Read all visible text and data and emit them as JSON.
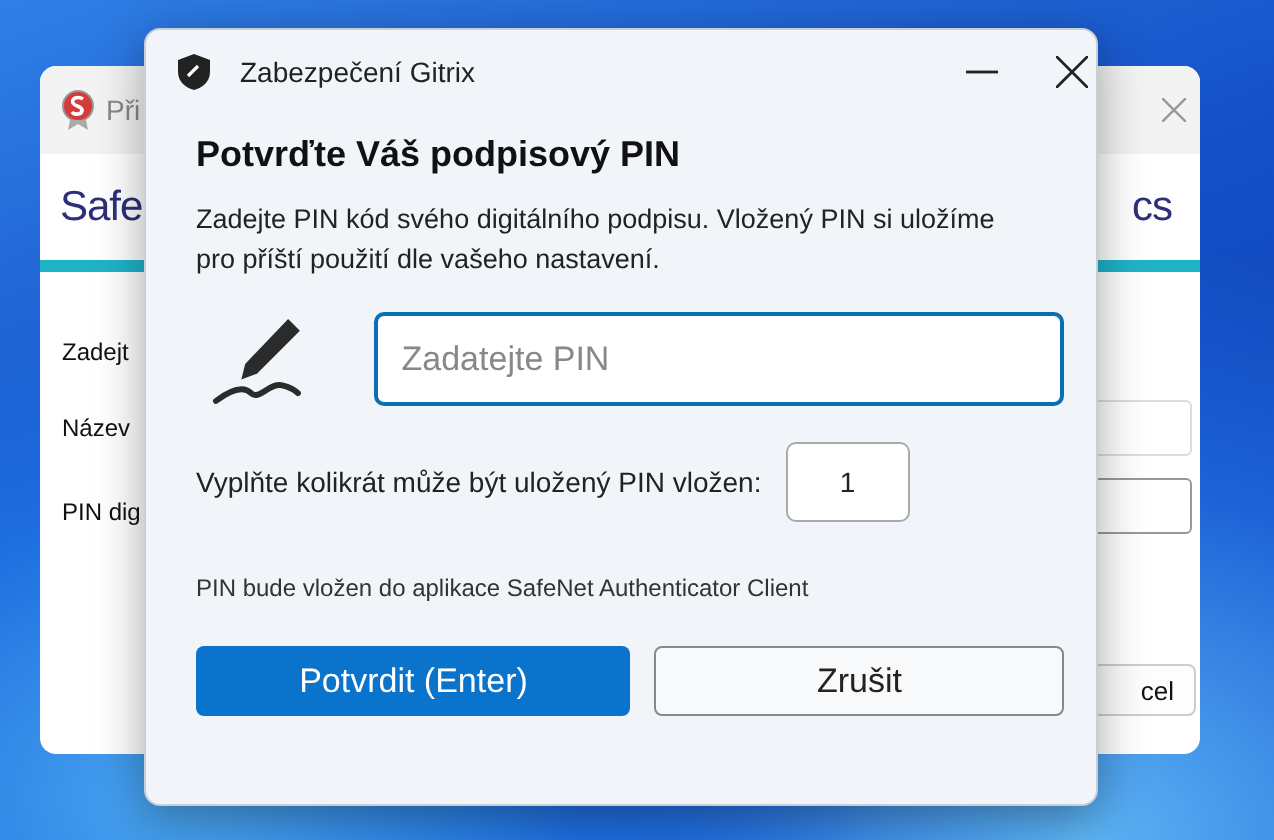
{
  "background_window": {
    "title": "Při",
    "logo_left": "Safe",
    "logo_right": "cs",
    "labels": [
      "Zadejt",
      "Název",
      "PIN dig"
    ],
    "button": "cel"
  },
  "dialog": {
    "title": "Zabezpečení Gitrix",
    "heading": "Potvrďte Váš podpisový PIN",
    "description": "Zadejte PIN kód svého digitálního podpisu. Vložený PIN si uložíme pro příští použití dle vašeho nastavení.",
    "pin_field": {
      "placeholder": "Zadatejte PIN"
    },
    "count_label": "Vyplňte kolikrát může být uložený PIN vložen:",
    "count_field": {
      "value": "1"
    },
    "note": "PIN bude vložen do aplikace SafeNet Authenticator Client",
    "buttons": [
      {
        "label": "Potvrdit (Enter)",
        "kind": "primary"
      },
      {
        "label": "Zrušit",
        "kind": "secondary"
      }
    ]
  }
}
